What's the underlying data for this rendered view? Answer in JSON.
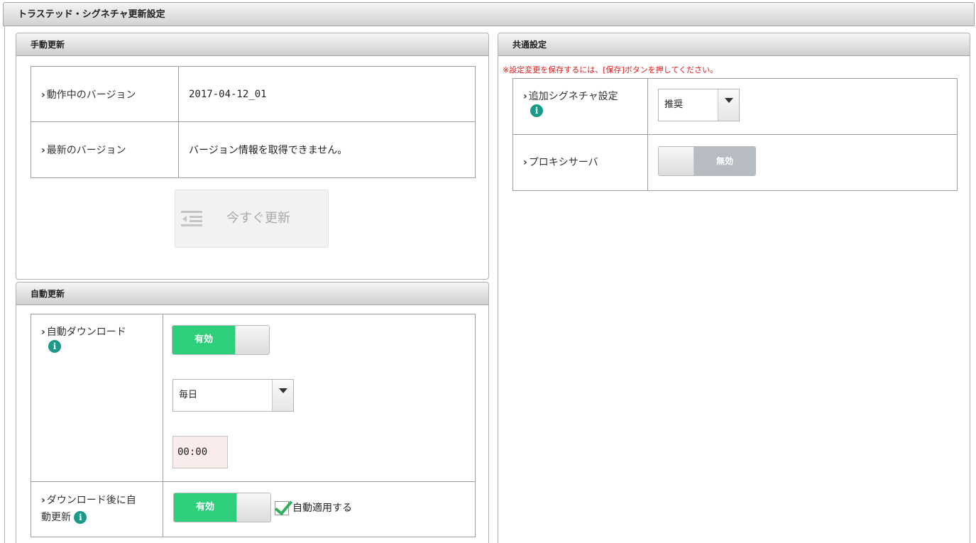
{
  "window": {
    "title": "トラステッド・シグネチャ更新設定"
  },
  "manual": {
    "title": "手動更新",
    "rows": [
      {
        "label": "動作中のバージョン",
        "value": "2017-04-12_01"
      },
      {
        "label": "最新のバージョン",
        "value": "バージョン情報を取得できません。"
      }
    ],
    "update_button": "今すぐ更新"
  },
  "auto": {
    "title": "自動更新",
    "download_label": "自動ダウンロード",
    "download_toggle": "有効",
    "frequency": "毎日",
    "time": "00:00",
    "after_label_1": "ダウンロード後に自",
    "after_label_2": "動更新",
    "after_toggle": "有効",
    "auto_apply_label": "自動適用する"
  },
  "common": {
    "title": "共通設定",
    "note": "※設定変更を保存するには、[保存]ボタンを押してください。",
    "sig_label": "追加シグネチャ設定",
    "sig_value": "推奨",
    "proxy_label": "プロキシサーバ",
    "proxy_toggle": "無効"
  },
  "icons": {
    "chevron": "chevron-right-icon",
    "info": "info-icon",
    "update": "list-indent-icon"
  },
  "colors": {
    "toggle_on": "#2ecf7a",
    "toggle_off": "#b6bcc2",
    "note": "#e01919",
    "info": "#1a9a88"
  }
}
